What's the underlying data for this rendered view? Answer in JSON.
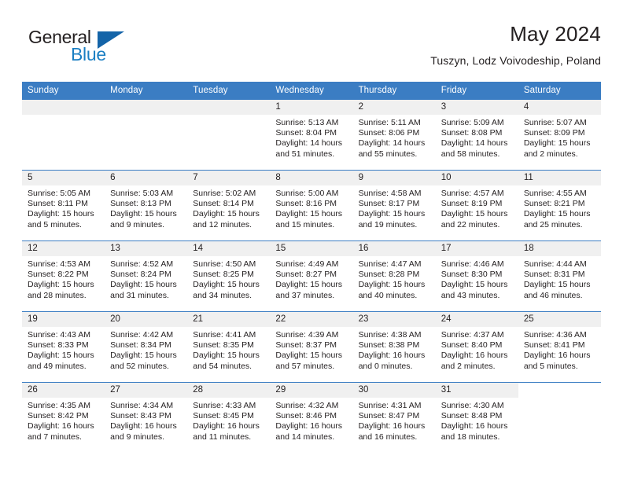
{
  "brand": {
    "name_line1": "General",
    "name_line2": "Blue",
    "triangle_color": "#1464a8",
    "blue_color": "#1b7fc3"
  },
  "header": {
    "title": "May 2024",
    "subtitle": "Tuszyn, Lodz Voivodeship, Poland"
  },
  "theme": {
    "header_blue": "#3b7dc3",
    "date_band_gray": "#f0f0f0",
    "text_color": "#231f20"
  },
  "calendar": {
    "weekday_headers": [
      "Sunday",
      "Monday",
      "Tuesday",
      "Wednesday",
      "Thursday",
      "Friday",
      "Saturday"
    ],
    "weeks": [
      [
        {
          "day": "",
          "state": "blank",
          "lines": []
        },
        {
          "day": "",
          "state": "blank",
          "lines": []
        },
        {
          "day": "",
          "state": "blank",
          "lines": []
        },
        {
          "day": "1",
          "state": "filled",
          "lines": [
            "Sunrise: 5:13 AM",
            "Sunset: 8:04 PM",
            "Daylight: 14 hours",
            "and 51 minutes."
          ]
        },
        {
          "day": "2",
          "state": "filled",
          "lines": [
            "Sunrise: 5:11 AM",
            "Sunset: 8:06 PM",
            "Daylight: 14 hours",
            "and 55 minutes."
          ]
        },
        {
          "day": "3",
          "state": "filled",
          "lines": [
            "Sunrise: 5:09 AM",
            "Sunset: 8:08 PM",
            "Daylight: 14 hours",
            "and 58 minutes."
          ]
        },
        {
          "day": "4",
          "state": "filled",
          "lines": [
            "Sunrise: 5:07 AM",
            "Sunset: 8:09 PM",
            "Daylight: 15 hours",
            "and 2 minutes."
          ]
        }
      ],
      [
        {
          "day": "5",
          "state": "filled",
          "lines": [
            "Sunrise: 5:05 AM",
            "Sunset: 8:11 PM",
            "Daylight: 15 hours",
            "and 5 minutes."
          ]
        },
        {
          "day": "6",
          "state": "filled",
          "lines": [
            "Sunrise: 5:03 AM",
            "Sunset: 8:13 PM",
            "Daylight: 15 hours",
            "and 9 minutes."
          ]
        },
        {
          "day": "7",
          "state": "filled",
          "lines": [
            "Sunrise: 5:02 AM",
            "Sunset: 8:14 PM",
            "Daylight: 15 hours",
            "and 12 minutes."
          ]
        },
        {
          "day": "8",
          "state": "filled",
          "lines": [
            "Sunrise: 5:00 AM",
            "Sunset: 8:16 PM",
            "Daylight: 15 hours",
            "and 15 minutes."
          ]
        },
        {
          "day": "9",
          "state": "filled",
          "lines": [
            "Sunrise: 4:58 AM",
            "Sunset: 8:17 PM",
            "Daylight: 15 hours",
            "and 19 minutes."
          ]
        },
        {
          "day": "10",
          "state": "filled",
          "lines": [
            "Sunrise: 4:57 AM",
            "Sunset: 8:19 PM",
            "Daylight: 15 hours",
            "and 22 minutes."
          ]
        },
        {
          "day": "11",
          "state": "filled",
          "lines": [
            "Sunrise: 4:55 AM",
            "Sunset: 8:21 PM",
            "Daylight: 15 hours",
            "and 25 minutes."
          ]
        }
      ],
      [
        {
          "day": "12",
          "state": "filled",
          "lines": [
            "Sunrise: 4:53 AM",
            "Sunset: 8:22 PM",
            "Daylight: 15 hours",
            "and 28 minutes."
          ]
        },
        {
          "day": "13",
          "state": "filled",
          "lines": [
            "Sunrise: 4:52 AM",
            "Sunset: 8:24 PM",
            "Daylight: 15 hours",
            "and 31 minutes."
          ]
        },
        {
          "day": "14",
          "state": "filled",
          "lines": [
            "Sunrise: 4:50 AM",
            "Sunset: 8:25 PM",
            "Daylight: 15 hours",
            "and 34 minutes."
          ]
        },
        {
          "day": "15",
          "state": "filled",
          "lines": [
            "Sunrise: 4:49 AM",
            "Sunset: 8:27 PM",
            "Daylight: 15 hours",
            "and 37 minutes."
          ]
        },
        {
          "day": "16",
          "state": "filled",
          "lines": [
            "Sunrise: 4:47 AM",
            "Sunset: 8:28 PM",
            "Daylight: 15 hours",
            "and 40 minutes."
          ]
        },
        {
          "day": "17",
          "state": "filled",
          "lines": [
            "Sunrise: 4:46 AM",
            "Sunset: 8:30 PM",
            "Daylight: 15 hours",
            "and 43 minutes."
          ]
        },
        {
          "day": "18",
          "state": "filled",
          "lines": [
            "Sunrise: 4:44 AM",
            "Sunset: 8:31 PM",
            "Daylight: 15 hours",
            "and 46 minutes."
          ]
        }
      ],
      [
        {
          "day": "19",
          "state": "filled",
          "lines": [
            "Sunrise: 4:43 AM",
            "Sunset: 8:33 PM",
            "Daylight: 15 hours",
            "and 49 minutes."
          ]
        },
        {
          "day": "20",
          "state": "filled",
          "lines": [
            "Sunrise: 4:42 AM",
            "Sunset: 8:34 PM",
            "Daylight: 15 hours",
            "and 52 minutes."
          ]
        },
        {
          "day": "21",
          "state": "filled",
          "lines": [
            "Sunrise: 4:41 AM",
            "Sunset: 8:35 PM",
            "Daylight: 15 hours",
            "and 54 minutes."
          ]
        },
        {
          "day": "22",
          "state": "filled",
          "lines": [
            "Sunrise: 4:39 AM",
            "Sunset: 8:37 PM",
            "Daylight: 15 hours",
            "and 57 minutes."
          ]
        },
        {
          "day": "23",
          "state": "filled",
          "lines": [
            "Sunrise: 4:38 AM",
            "Sunset: 8:38 PM",
            "Daylight: 16 hours",
            "and 0 minutes."
          ]
        },
        {
          "day": "24",
          "state": "filled",
          "lines": [
            "Sunrise: 4:37 AM",
            "Sunset: 8:40 PM",
            "Daylight: 16 hours",
            "and 2 minutes."
          ]
        },
        {
          "day": "25",
          "state": "filled",
          "lines": [
            "Sunrise: 4:36 AM",
            "Sunset: 8:41 PM",
            "Daylight: 16 hours",
            "and 5 minutes."
          ]
        }
      ],
      [
        {
          "day": "26",
          "state": "filled",
          "lines": [
            "Sunrise: 4:35 AM",
            "Sunset: 8:42 PM",
            "Daylight: 16 hours",
            "and 7 minutes."
          ]
        },
        {
          "day": "27",
          "state": "filled",
          "lines": [
            "Sunrise: 4:34 AM",
            "Sunset: 8:43 PM",
            "Daylight: 16 hours",
            "and 9 minutes."
          ]
        },
        {
          "day": "28",
          "state": "filled",
          "lines": [
            "Sunrise: 4:33 AM",
            "Sunset: 8:45 PM",
            "Daylight: 16 hours",
            "and 11 minutes."
          ]
        },
        {
          "day": "29",
          "state": "filled",
          "lines": [
            "Sunrise: 4:32 AM",
            "Sunset: 8:46 PM",
            "Daylight: 16 hours",
            "and 14 minutes."
          ]
        },
        {
          "day": "30",
          "state": "filled",
          "lines": [
            "Sunrise: 4:31 AM",
            "Sunset: 8:47 PM",
            "Daylight: 16 hours",
            "and 16 minutes."
          ]
        },
        {
          "day": "31",
          "state": "filled",
          "lines": [
            "Sunrise: 4:30 AM",
            "Sunset: 8:48 PM",
            "Daylight: 16 hours",
            "and 18 minutes."
          ]
        },
        {
          "day": "",
          "state": "empty",
          "lines": []
        }
      ]
    ]
  }
}
